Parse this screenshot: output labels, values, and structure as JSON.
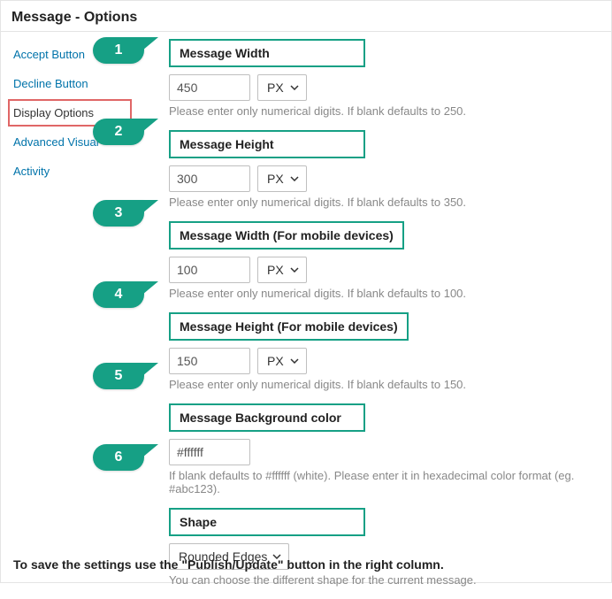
{
  "header": {
    "title": "Message - Options"
  },
  "sidebar": {
    "items": [
      {
        "label": "Accept Button"
      },
      {
        "label": "Decline Button"
      },
      {
        "label": "Display Options"
      },
      {
        "label": "Advanced Visual"
      },
      {
        "label": "Activity"
      }
    ]
  },
  "callouts": {
    "n1": "1",
    "n2": "2",
    "n3": "3",
    "n4": "4",
    "n5": "5",
    "n6": "6"
  },
  "fields": {
    "width": {
      "label": "Message Width",
      "value": "450",
      "unit": "PX",
      "hint": "Please enter only numerical digits. If blank defaults to 250."
    },
    "height": {
      "label": "Message Height",
      "value": "300",
      "unit": "PX",
      "hint": "Please enter only numerical digits. If blank defaults to 350."
    },
    "widthMobile": {
      "label": "Message Width (For mobile devices)",
      "value": "100",
      "unit": "PX",
      "hint": "Please enter only numerical digits. If blank defaults to 100."
    },
    "heightMobile": {
      "label": "Message Height (For mobile devices)",
      "value": "150",
      "unit": "PX",
      "hint": "Please enter only numerical digits. If blank defaults to 150."
    },
    "bg": {
      "label": "Message Background color",
      "value": "#ffffff",
      "hint": "If blank defaults to #ffffff (white). Please enter it in hexadecimal color format (eg. #abc123)."
    },
    "shape": {
      "label": "Shape",
      "value": "Rounded Edges",
      "hint": "You can choose the different shape for the current message."
    }
  },
  "footer": {
    "note": "To save the settings use the \"Publish/Update\" button in the right column."
  }
}
